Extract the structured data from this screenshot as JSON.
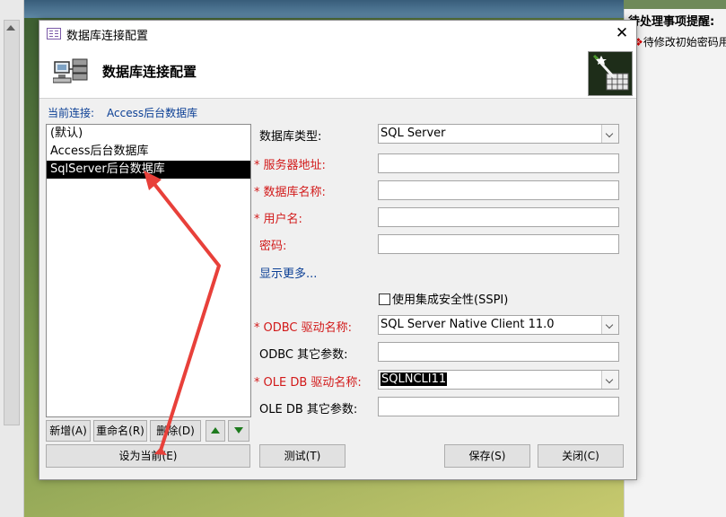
{
  "background": {
    "reminder_title": "待处理事项提醒:",
    "reminder_item": "待修改初始密码用"
  },
  "dialog": {
    "window_title": "数据库连接配置",
    "header_title": "数据库连接配置",
    "current_label": "当前连接:",
    "current_value": "Access后台数据库"
  },
  "connections": [
    {
      "label": "(默认)",
      "selected": false
    },
    {
      "label": "Access后台数据库",
      "selected": false
    },
    {
      "label": "SqlServer后台数据库",
      "selected": true
    }
  ],
  "form": {
    "db_type_label": "数据库类型:",
    "db_type_value": "SQL Server",
    "server_label": "服务器地址:",
    "server_value": "",
    "dbname_label": "数据库名称:",
    "dbname_value": "",
    "user_label": "用户名:",
    "user_value": "",
    "password_label": "密码:",
    "password_value": "",
    "show_more": "显示更多...",
    "sspi_label": "使用集成安全性(SSPI)",
    "sspi_checked": false,
    "odbc_driver_label": "ODBC 驱动名称:",
    "odbc_driver_value": "SQL Server Native Client 11.0",
    "odbc_params_label": "ODBC 其它参数:",
    "odbc_params_value": "",
    "oledb_driver_label": "OLE DB 驱动名称:",
    "oledb_driver_value": "SQLNCLI11",
    "oledb_params_label": "OLE DB 其它参数:",
    "oledb_params_value": ""
  },
  "buttons": {
    "new": "新增(A)",
    "rename": "重命名(R)",
    "delete": "删除(D)",
    "set_current": "设为当前(E)",
    "test": "测试(T)",
    "save": "保存(S)",
    "close": "关闭(C)"
  },
  "colors": {
    "required_label": "#d21a1a",
    "link_blue": "#0b3f95",
    "annotation_red": "#e8403a"
  }
}
